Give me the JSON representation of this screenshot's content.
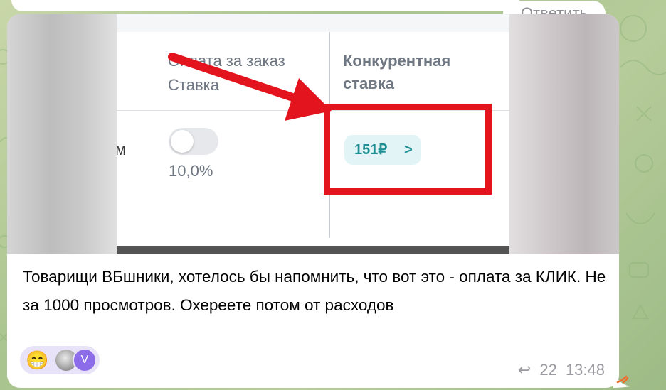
{
  "reply_button_label": "Ответить",
  "screenshot": {
    "header_col1_line1": "Оплата за заказ",
    "header_col1_line2": "Ставка",
    "header_col2_line1": "Конкурентная",
    "header_col2_line2": "ставка",
    "cut_row_text": "м",
    "toggle_percent": "10,0%",
    "competitive_bid": "151₽",
    "chip_chevron": ">"
  },
  "caption": "Товарищи ВБшники, хотелось бы напомнить, что вот это - оплата за КЛИК. Не за 1000 просмотров. Охереете потом от расходов",
  "reactions": {
    "emoji": "😁",
    "avatar_letter": "V"
  },
  "meta": {
    "replies_icon": "reply-arrow-icon",
    "replies_count": "22",
    "time": "13:48"
  },
  "colors": {
    "accent_red": "#e3141d",
    "chip_text": "#1f8f93",
    "chip_bg": "#e2f4f5",
    "reaction_bg": "#e8e3f8"
  }
}
